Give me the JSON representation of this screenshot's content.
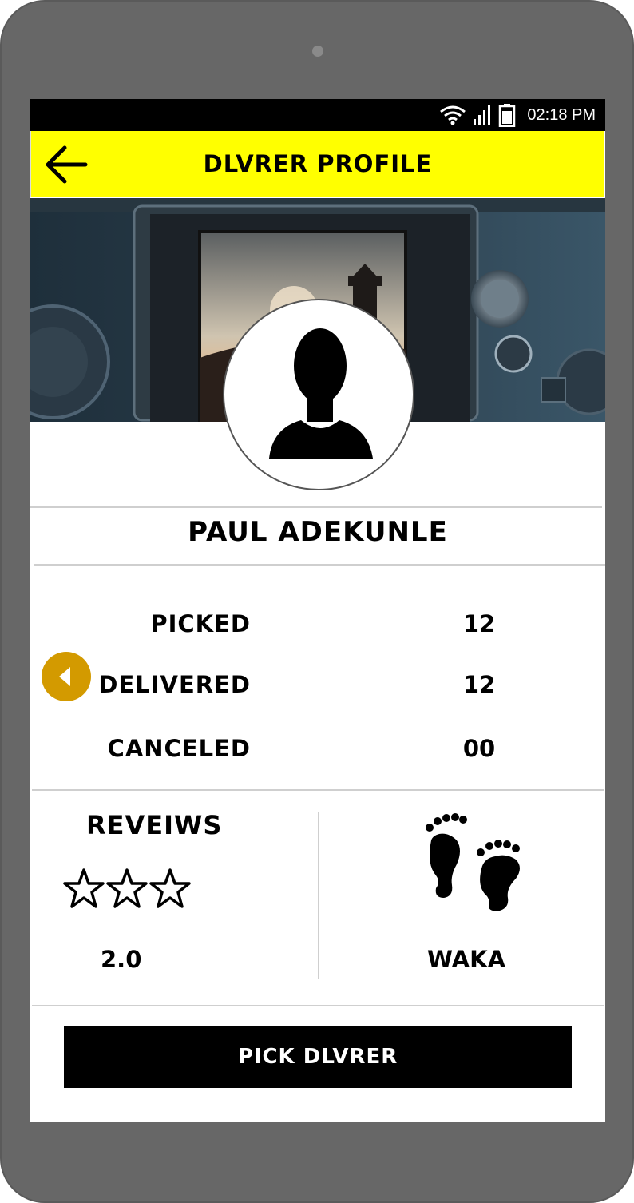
{
  "status_bar": {
    "time": "02:18 PM",
    "icons": [
      "wifi-icon",
      "signal-icon",
      "battery-icon"
    ]
  },
  "app_bar": {
    "back_icon": "arrow-left-icon",
    "title": "DLVRER PROFILE",
    "background_color": "#ffff00"
  },
  "profile": {
    "cover_image": "camera-viewfinder-lighthouse-photo",
    "avatar_icon": "user-silhouette-icon",
    "name": "PAUL ADEKUNLE"
  },
  "stats": [
    {
      "label": "PICKED",
      "value": "12"
    },
    {
      "label": "DELIVERED",
      "value": "12"
    },
    {
      "label": "CANCELED",
      "value": "00"
    }
  ],
  "collapse_button": {
    "icon": "caret-left-icon",
    "color": "#d39a00"
  },
  "reviews": {
    "title": "REVEIWS",
    "stars_outline_count": 3,
    "rating": "2.0"
  },
  "provider": {
    "icon": "footprints-icon",
    "name": "WAKA"
  },
  "action": {
    "label": "PICK DLVRER"
  }
}
